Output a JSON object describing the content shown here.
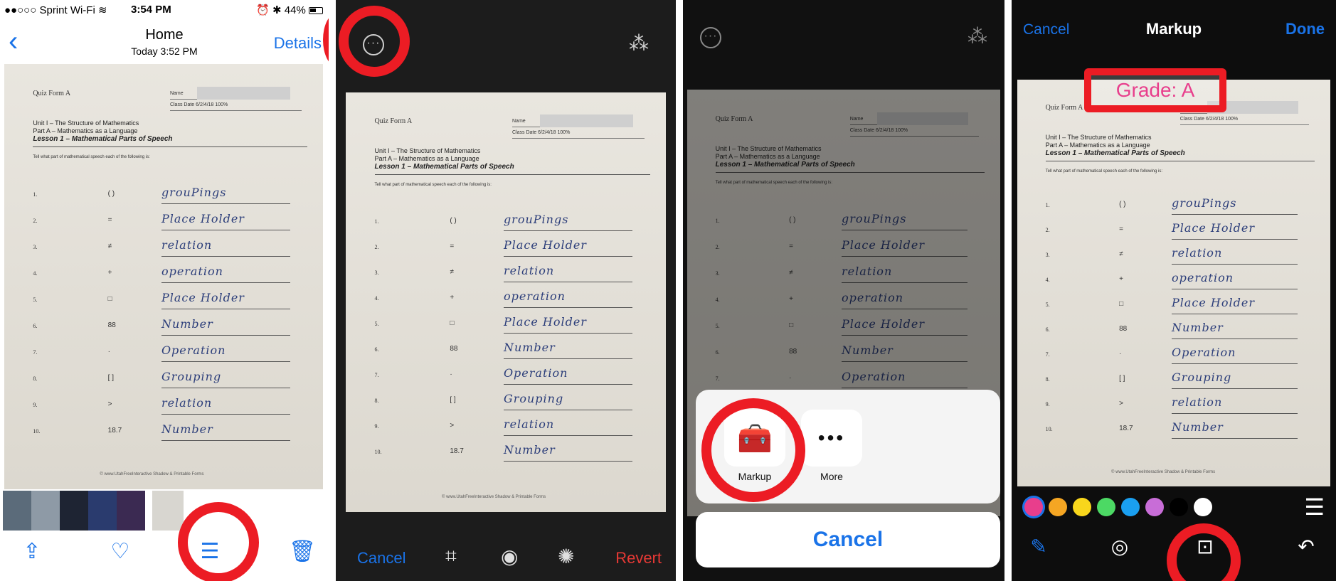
{
  "panel1": {
    "status": {
      "carrier": "●●○○○ Sprint Wi-Fi",
      "wifi_icon": "wifi-icon",
      "time": "3:54 PM",
      "icons": "⏰ ✱",
      "battery": "44%"
    },
    "nav": {
      "back_icon": "back-chevron-icon",
      "title": "Home",
      "subtitle": "Today 3:52 PM",
      "details": "Details"
    },
    "toolbar": {
      "share_icon": "share-icon",
      "favorite_icon": "heart-icon",
      "edit_icon": "sliders-icon",
      "delete_icon": "trash-icon"
    }
  },
  "worksheet": {
    "quiz_label": "Quiz Form A",
    "name_label": "Name",
    "class_label": "Class",
    "date_label": "Date 6/2/4/18",
    "score": "100%",
    "unit": "Unit I – The Structure of Mathematics",
    "part": "Part A – Mathematics as a Language",
    "lesson": "Lesson 1 – Mathematical Parts of Speech",
    "instructions": "Tell what part of mathematical speech each of the following is:",
    "rows": [
      {
        "num": "1.",
        "sym": "( )",
        "answer": "grouPings"
      },
      {
        "num": "2.",
        "sym": "=",
        "answer": "Place Holder"
      },
      {
        "num": "3.",
        "sym": "≠",
        "answer": "relation"
      },
      {
        "num": "4.",
        "sym": "+",
        "answer": "operation"
      },
      {
        "num": "5.",
        "sym": "□",
        "answer": "Place Holder"
      },
      {
        "num": "6.",
        "sym": "88",
        "answer": "Number"
      },
      {
        "num": "7.",
        "sym": "·",
        "answer": "Operation"
      },
      {
        "num": "8.",
        "sym": "[ ]",
        "answer": "Grouping"
      },
      {
        "num": "9.",
        "sym": ">",
        "answer": "relation"
      },
      {
        "num": "10.",
        "sym": "18.7",
        "answer": "Number"
      }
    ],
    "footer": "© www.UtahFreeInteractive Shadow & Printable Forms"
  },
  "panel2": {
    "more_icon": "more-circle-icon",
    "enhance_icon": "magic-wand-icon",
    "cancel": "Cancel",
    "crop_icon": "crop-icon",
    "filters_icon": "filters-icon",
    "adjust_icon": "adjust-dial-icon",
    "revert": "Revert"
  },
  "panel3": {
    "more_icon": "more-circle-icon",
    "enhance_icon": "magic-wand-icon",
    "sheet_items": [
      {
        "label": "Markup",
        "icon": "toolbox-icon"
      },
      {
        "label": "More",
        "icon": "more-dots-icon"
      }
    ],
    "cancel": "Cancel"
  },
  "panel4": {
    "cancel": "Cancel",
    "title": "Markup",
    "done": "Done",
    "annotation_text": "Grade: A",
    "colors": [
      "#e83e8c",
      "#f5a623",
      "#f8d61c",
      "#4cd964",
      "#1a9ff0",
      "#c86dd7",
      "#000000",
      "#ffffff"
    ],
    "selected_color": "#e83e8c",
    "list_icon": "menu-lines-icon",
    "pen_icon": "pen-icon",
    "magnifier_icon": "magnifier-icon",
    "text_icon": "text-box-icon",
    "undo_icon": "undo-icon"
  },
  "highlight_color": "#ec1c24"
}
